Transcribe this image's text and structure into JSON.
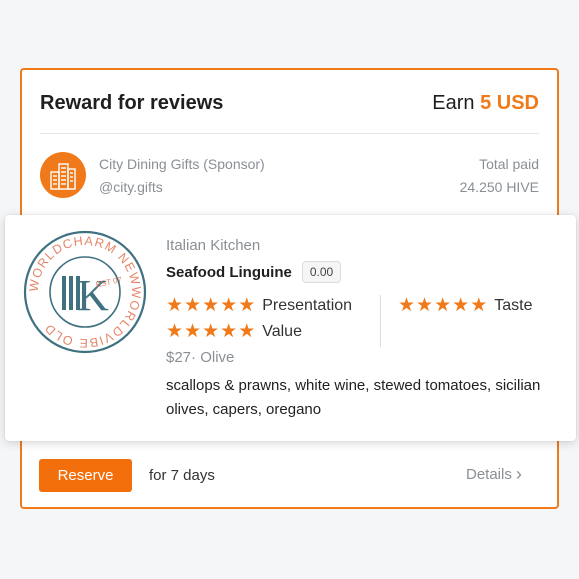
{
  "header": {
    "title": "Reward for reviews",
    "earn_prefix": "Earn",
    "earn_amount": "5 USD"
  },
  "sponsor": {
    "name": "City Dining Gifts (Sponsor)",
    "handle": "@city.gifts",
    "logo_icon": "city-buildings-icon",
    "total_paid_label": "Total paid",
    "total_paid_value": "24.250 HIVE"
  },
  "review": {
    "restaurant_logo": {
      "monogram": "K",
      "est": "EST 07",
      "ring_text": "WORLDCHARM NEWWORLDVIBE OLD"
    },
    "cuisine": "Italian Kitchen",
    "dish": "Seafood Linguine",
    "score": "0.00",
    "ratings": [
      {
        "label": "Presentation",
        "stars": 5
      },
      {
        "label": "Taste",
        "stars": 5
      },
      {
        "label": "Value",
        "stars": 5
      }
    ],
    "price": "$27",
    "price_separator": "·",
    "venue": "Olive",
    "description": "scallops & prawns, white wine, stewed tomatoes, sicilian olives, capers, oregano"
  },
  "footer": {
    "reserve_label": "Reserve",
    "duration": "for 7 days",
    "details_label": "Details"
  },
  "colors": {
    "accent": "#f07a1a",
    "muted_text": "#8a8f96",
    "logo_teal": "#3f7181",
    "logo_orange": "#e5866a"
  }
}
